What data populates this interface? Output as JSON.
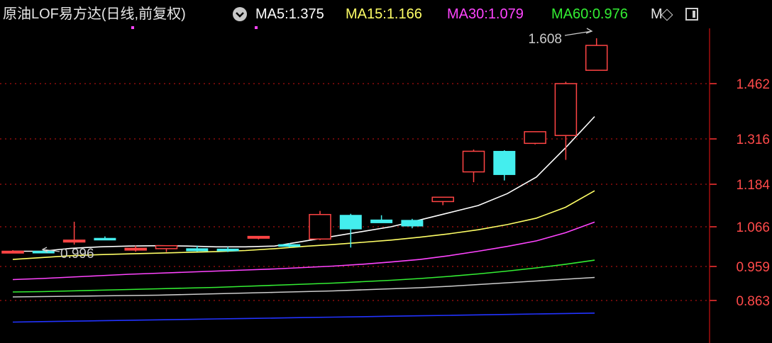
{
  "header": {
    "title": "原油LOF易方达(日线,前复权)",
    "overflow_label": "M",
    "indicators": [
      {
        "label": "MA5:",
        "value": "1.375",
        "color": "#ffffff"
      },
      {
        "label": "MA15:",
        "value": "1.166",
        "color": "#ffff66"
      },
      {
        "label": "MA30:",
        "value": "1.079",
        "color": "#ff44ff"
      },
      {
        "label": "MA60:",
        "value": "0.976",
        "color": "#33ee33"
      }
    ]
  },
  "colors": {
    "up": "#ff4444",
    "down": "#44eeee",
    "grid": "#aa1111",
    "axis_text": "#ff4a4a",
    "ma5": "#ffffff",
    "ma15": "#ffff66",
    "ma30": "#ff44ff",
    "ma60": "#33ee33",
    "ma_gray": "#cccccc",
    "ma_blue": "#2233ff"
  },
  "chart_data": {
    "type": "candlestick",
    "y_ticks": [
      1.462,
      1.316,
      1.184,
      1.066,
      0.959,
      0.863
    ],
    "y_tick_labels": [
      "1.462",
      "1.316",
      "1.184",
      "1.066",
      "0.959",
      "0.863"
    ],
    "high_annotation": "1.608",
    "low_annotation": "0.996",
    "candles": [
      {
        "o": 1.0,
        "h": 1.003,
        "l": 0.996,
        "c": 1.0
      },
      {
        "o": 1.0,
        "h": 1.003,
        "l": 0.997,
        "c": 0.999
      },
      {
        "o": 1.025,
        "h": 1.08,
        "l": 1.018,
        "c": 1.03
      },
      {
        "o": 1.035,
        "h": 1.04,
        "l": 1.03,
        "c": 1.033
      },
      {
        "o": 1.008,
        "h": 1.015,
        "l": 0.999,
        "c": 1.008
      },
      {
        "o": 1.007,
        "h": 1.012,
        "l": 0.998,
        "c": 1.015
      },
      {
        "o": 1.007,
        "h": 1.015,
        "l": 0.999,
        "c": 1.001
      },
      {
        "o": 1.006,
        "h": 1.012,
        "l": 0.998,
        "c": 1.001
      },
      {
        "o": 1.036,
        "h": 1.04,
        "l": 1.032,
        "c": 1.04
      },
      {
        "o": 1.018,
        "h": 1.022,
        "l": 1.01,
        "c": 1.015
      },
      {
        "o": 1.033,
        "h": 1.11,
        "l": 1.03,
        "c": 1.1
      },
      {
        "o": 1.098,
        "h": 1.102,
        "l": 1.01,
        "c": 1.06
      },
      {
        "o": 1.085,
        "h": 1.098,
        "l": 1.078,
        "c": 1.077
      },
      {
        "o": 1.084,
        "h": 1.088,
        "l": 1.062,
        "c": 1.068
      },
      {
        "o": 1.136,
        "h": 1.148,
        "l": 1.126,
        "c": 1.148
      },
      {
        "o": 1.22,
        "h": 1.285,
        "l": 1.19,
        "c": 1.28
      },
      {
        "o": 1.28,
        "h": 1.283,
        "l": 1.195,
        "c": 1.212
      },
      {
        "o": 1.303,
        "h": 1.335,
        "l": 1.3,
        "c": 1.335
      },
      {
        "o": 1.325,
        "h": 1.468,
        "l": 1.255,
        "c": 1.462
      },
      {
        "o": 1.505,
        "h": 1.608,
        "l": 1.505,
        "c": 1.585
      }
    ],
    "series": [
      {
        "key": "ma5",
        "values": [
          1.0,
          1.0,
          1.008,
          1.012,
          1.014,
          1.015,
          1.014,
          1.012,
          1.012,
          1.014,
          1.027,
          1.04,
          1.053,
          1.066,
          1.085,
          1.105,
          1.125,
          1.158,
          1.205,
          1.29,
          1.375
        ]
      },
      {
        "key": "ma15",
        "values": [
          0.978,
          0.983,
          0.988,
          0.991,
          0.993,
          0.995,
          0.997,
          0.999,
          1.002,
          1.007,
          1.013,
          1.018,
          1.024,
          1.03,
          1.038,
          1.047,
          1.058,
          1.072,
          1.09,
          1.12,
          1.166
        ]
      },
      {
        "key": "ma30",
        "values": [
          0.922,
          0.925,
          0.929,
          0.933,
          0.937,
          0.94,
          0.943,
          0.946,
          0.949,
          0.952,
          0.956,
          0.96,
          0.965,
          0.971,
          0.978,
          0.988,
          1.0,
          1.013,
          1.028,
          1.05,
          1.079
        ]
      },
      {
        "key": "ma60",
        "values": [
          0.887,
          0.888,
          0.89,
          0.892,
          0.894,
          0.896,
          0.898,
          0.9,
          0.903,
          0.906,
          0.909,
          0.912,
          0.916,
          0.92,
          0.925,
          0.931,
          0.938,
          0.946,
          0.955,
          0.965,
          0.976
        ]
      },
      {
        "key": "ma_gray",
        "values": [
          0.873,
          0.874,
          0.875,
          0.876,
          0.877,
          0.878,
          0.88,
          0.882,
          0.884,
          0.886,
          0.888,
          0.89,
          0.893,
          0.896,
          0.899,
          0.903,
          0.908,
          0.913,
          0.918,
          0.923,
          0.928
        ]
      },
      {
        "key": "ma_blue",
        "values": [
          0.815,
          0.816,
          0.817,
          0.818,
          0.819,
          0.82,
          0.821,
          0.822,
          0.823,
          0.824,
          0.825,
          0.826,
          0.827,
          0.828,
          0.829,
          0.83,
          0.831,
          0.832,
          0.833,
          0.834,
          0.835
        ]
      }
    ]
  }
}
